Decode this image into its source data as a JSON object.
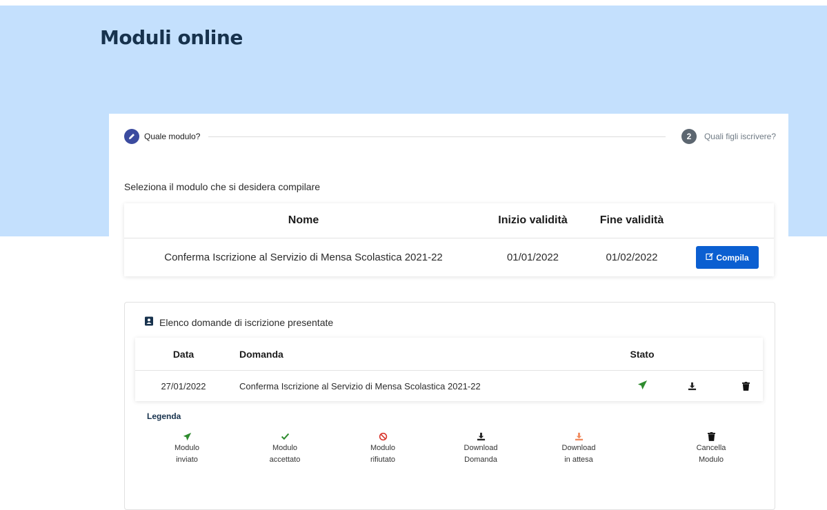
{
  "page": {
    "title": "Moduli online"
  },
  "stepper": {
    "step1": {
      "label": "Quale modulo?",
      "icon": "pencil-icon"
    },
    "step2": {
      "number": "2",
      "label": "Quali figli iscrivere?"
    }
  },
  "moduli": {
    "instruction": "Seleziona il modulo che si desidera compilare",
    "headers": {
      "nome": "Nome",
      "inizio": "Inizio validità",
      "fine": "Fine validità"
    },
    "rows": [
      {
        "nome": "Conferma Iscrizione al Servizio di Mensa Scolastica 2021-22",
        "inizio": "01/01/2022",
        "fine": "01/02/2022",
        "action_label": "Compila"
      }
    ]
  },
  "domande": {
    "title": "Elenco domande di iscrizione presentate",
    "headers": {
      "data": "Data",
      "domanda": "Domanda",
      "stato": "Stato"
    },
    "rows": [
      {
        "data": "27/01/2022",
        "domanda": "Conferma Iscrizione al Servizio di Mensa Scolastica 2021-22",
        "stato_icon": "paper-plane-icon"
      }
    ]
  },
  "legenda": {
    "title": "Legenda",
    "items": [
      {
        "line1": "Modulo",
        "line2": "inviato",
        "icon": "paper-plane-icon",
        "color": "#2e8b2e"
      },
      {
        "line1": "Modulo",
        "line2": "accettato",
        "icon": "check-icon",
        "color": "#2e8b2e"
      },
      {
        "line1": "Modulo",
        "line2": "rifiutato",
        "icon": "ban-icon",
        "color": "#d9342b"
      },
      {
        "line1": "Download",
        "line2": "Domanda",
        "icon": "download-icon",
        "color": "#222222"
      },
      {
        "line1": "Download",
        "line2": "in attesa",
        "icon": "download-icon",
        "color": "#f08a5d"
      },
      {
        "line1": "Cancella",
        "line2": "Modulo",
        "icon": "trash-icon",
        "color": "#111111"
      }
    ]
  },
  "colors": {
    "hero_bg": "#c4e0fd",
    "title": "#17324d",
    "primary_button": "#0b5fd1",
    "success": "#2e8b2e",
    "danger": "#d9342b",
    "pending": "#f08a5d"
  }
}
